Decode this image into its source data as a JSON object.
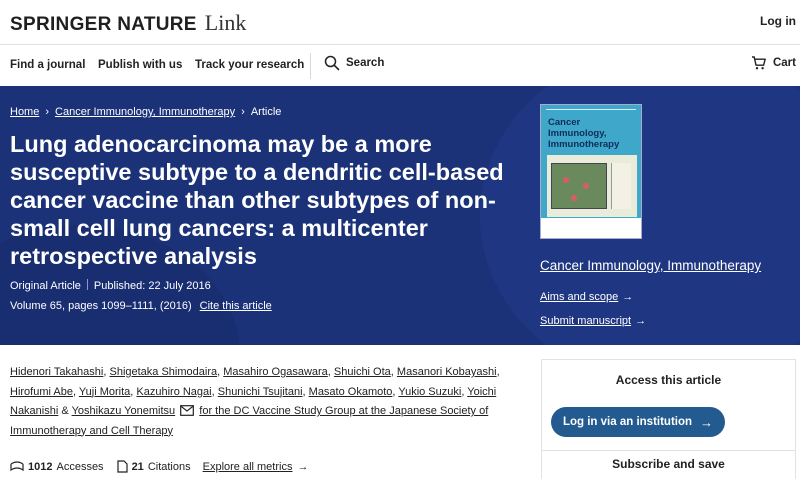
{
  "header": {
    "logo_main": "SPRINGER NATURE",
    "logo_link": "Link",
    "login": "Log in"
  },
  "nav": {
    "find_journal": "Find a journal",
    "publish": "Publish with us",
    "track": "Track your research",
    "search": "Search",
    "cart": "Cart"
  },
  "breadcrumb": {
    "home": "Home",
    "journal": "Cancer Immunology, Immunotherapy",
    "current": "Article"
  },
  "article": {
    "title": "Lung adenocarcinoma may be a more susceptive subtype to a dendritic cell-based cancer vaccine than other subtypes of non-small cell lung cancers: a multicenter retrospective analysis",
    "type": "Original Article",
    "published": "Published: 22 July 2016",
    "volume": "Volume 65, pages 1099–1111, (2016)",
    "cite": "Cite this article"
  },
  "journal": {
    "cover_title": "Cancer Immunology, Immunotherapy",
    "name": "Cancer Immunology, Immunotherapy",
    "aims": "Aims and scope",
    "submit": "Submit manuscript",
    "cover_color": "#3fa7c9"
  },
  "authors": {
    "list": [
      "Hidenori Takahashi",
      "Shigetaka Shimodaira",
      "Masahiro Ogasawara",
      "Shuichi Ota",
      "Masanori Kobayashi",
      "Hirofumi Abe",
      "Yuji Morita",
      "Kazuhiro Nagai",
      "Shunichi Tsujitani",
      "Masato Okamoto",
      "Yukio Suzuki",
      "Yoichi Nakanishi"
    ],
    "last": "Yoshikazu Yonemitsu",
    "group": "for the DC Vaccine Study Group at the Japanese Society of Immunotherapy and Cell Therapy"
  },
  "metrics": {
    "accesses_count": "1012",
    "accesses_label": "Accesses",
    "citations_count": "21",
    "citations_label": "Citations",
    "explore": "Explore all metrics"
  },
  "access": {
    "title": "Access this article",
    "login_button": "Log in via an institution",
    "subscribe": "Subscribe and save"
  },
  "colors": {
    "hero_bg": "#1b3278",
    "button": "#235a8f"
  }
}
